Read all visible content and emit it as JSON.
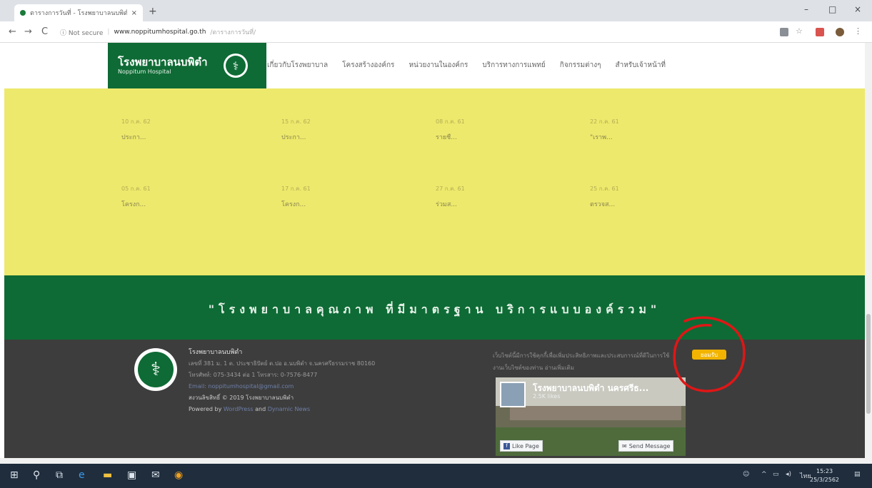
{
  "browser": {
    "tab_title": "ตารางการวันที่ - โรงพยาบาลนบพิตำ",
    "tab_close": "×",
    "new_tab": "+",
    "back": "←",
    "forward": "→",
    "reload": "C",
    "security_label": "ⓘ Not secure",
    "url": "www.noppitumhospital.go.th",
    "url_path": "/ตารางการวันที่/",
    "minimize": "–",
    "maximize": "□",
    "close": "×"
  },
  "site": {
    "brand_name": "โรงพยาบาลนบพิตำ",
    "brand_sub": "Noppitum Hospital",
    "nav": [
      "เกี่ยวกับโรงพยาบาล",
      "โครงสร้างองค์กร",
      "หน่วยงานในองค์กร",
      "บริการทางการแพทย์",
      "กิจกรรมต่างๆ",
      "สำหรับเจ้าหน้าที่"
    ],
    "news": [
      {
        "date": "10 ก.ค. 62",
        "title": "ประกา..."
      },
      {
        "date": "15 ก.ค. 62",
        "title": "ประกา..."
      },
      {
        "date": "08 ก.ค. 61",
        "title": "รายชื..."
      },
      {
        "date": "22 ก.ค. 61",
        "title": "\"เราพ..."
      },
      {
        "date": "05 ก.ค. 61",
        "title": "โครงก..."
      },
      {
        "date": "17 ก.ค. 61",
        "title": "โครงก..."
      },
      {
        "date": "27 ก.ค. 61",
        "title": "ร่วมส..."
      },
      {
        "date": "25 ก.ค. 61",
        "title": "ตรวจส..."
      }
    ],
    "slogan": "\"โรงพยาบาลคุณภาพ ที่มีมาตรฐาน บริการแบบองค์รวม\""
  },
  "footer": {
    "name": "โรงพยาบาลนบพิตำ",
    "address": "เลขที่ 381 ม. 1 ต. ประชาธิปัตย์ ต.ปอ อ.นบพิตำ จ.นครศรีธรรมราช 80160",
    "phone": "โทรศัพท์: 075-3434 ต่อ 1 โทรสาร: 0-7576-8477",
    "email": "Email: noppitumhospital@gmail.com",
    "copyright": "สงวนลิขสิทธิ์ © 2019 โรงพยาบาลนบพิตำ",
    "powered_prefix": "Powered by",
    "powered_wp": "WordPress",
    "powered_and": "and",
    "powered_theme": "Dynamic News",
    "cookie_text": "เว็บไซต์นี้มีการใช้คุกกี้เพื่อเพิ่มประสิทธิภาพและประสบการณ์ที่ดีในการใช้งานเว็บไซต์ของท่าน อ่านเพิ่มเติม",
    "accept_label": "ยอมรับ",
    "fb_name": "โรงพยาบาลนบพิตำ นครศรีธ...",
    "fb_sub": "2.5K likes",
    "fb_like": "Like Page",
    "fb_message": "Send Message"
  },
  "taskbar": {
    "time": "15:23",
    "date": "25/3/2562",
    "lang": "ไทย"
  },
  "colors": {
    "brand_green": "#0e6b35",
    "news_yellow": "#ede96c",
    "footer_dark": "#3d3d3d",
    "accept_yellow": "#f2b400",
    "annotation_red": "#e01616"
  }
}
